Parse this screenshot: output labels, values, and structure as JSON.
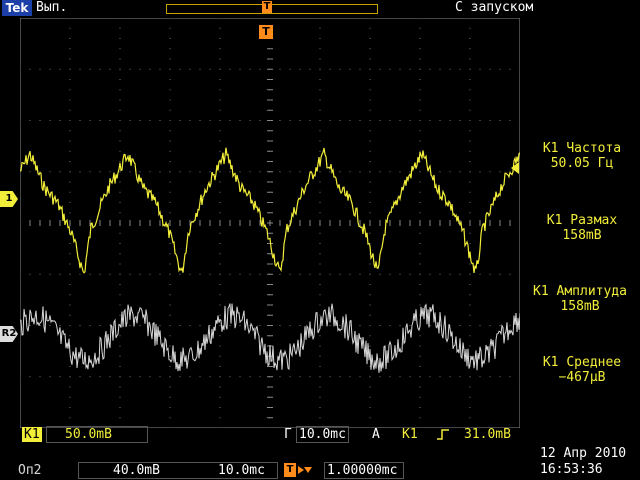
{
  "top": {
    "brand": "Tek",
    "status": "Вып.",
    "trigger_pos_marker": "T",
    "acquire_mode": "С запуском"
  },
  "screen": {
    "trigger_marker": "T",
    "channel_markers": {
      "ch1": "1",
      "ref2": "R2"
    }
  },
  "measurements": [
    {
      "label": "К1 Частота",
      "value": "50.05 Гц"
    },
    {
      "label": "К1 Размах",
      "value": "158mВ"
    },
    {
      "label": "К1 Амплитуда",
      "value": "158mВ"
    },
    {
      "label": "К1 Среднее",
      "value": "−467µВ"
    }
  ],
  "bottom": {
    "ch1_label": "К1",
    "ch1_scale": "50.0mВ",
    "timebase_prefix": "Г",
    "timebase": "10.0mс",
    "trigger_prefix": "А",
    "trigger_source": "К1",
    "trigger_slope_icon": "rising-edge-icon",
    "trigger_level": "31.0mВ",
    "ref_label": "Оп2",
    "ref_scale": "40.0mВ",
    "ref_timebase": "10.0mс",
    "delay": "1.00000mс",
    "date": "12 Апр 2010",
    "time": "16:53:36"
  },
  "colors": {
    "ch1": "#f2ee3a",
    "ref2": "#d8d8d8",
    "trigger": "#ff8c1a",
    "grid": "#777777"
  }
}
